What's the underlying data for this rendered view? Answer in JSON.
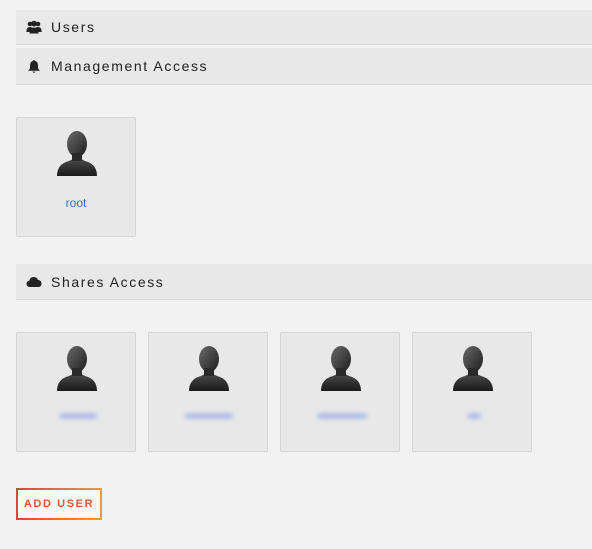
{
  "sections": {
    "users": {
      "title": "Users",
      "icon": "users-icon"
    },
    "management": {
      "title": "Management Access",
      "icon": "bell-icon"
    },
    "shares": {
      "title": "Shares Access",
      "icon": "cloud-icon"
    }
  },
  "management_users": [
    {
      "name": "root",
      "icon": "user-silhouette-icon"
    }
  ],
  "share_users": [
    {
      "name": "",
      "redacted": true,
      "icon": "user-silhouette-icon"
    },
    {
      "name": "",
      "redacted": true,
      "icon": "user-silhouette-icon"
    },
    {
      "name": "",
      "redacted": true,
      "icon": "user-silhouette-icon"
    },
    {
      "name": "",
      "redacted": true,
      "icon": "user-silhouette-icon"
    }
  ],
  "actions": {
    "add_user_label": "ADD USER"
  },
  "colors": {
    "background": "#f2f2f2",
    "header_bg": "#e8e8e8",
    "card_bg": "#e8e8e8",
    "link_blue": "#3a6fc4",
    "accent_red": "#e0423a",
    "accent_orange": "#f39a3a"
  }
}
